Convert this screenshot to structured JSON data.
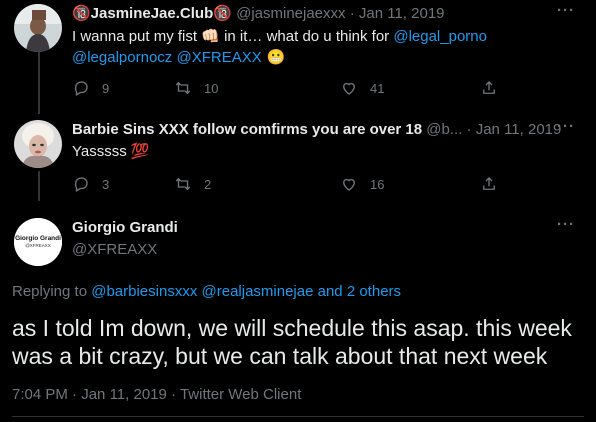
{
  "tweets": [
    {
      "display_name": "🔞JasmineJae.Club🔞",
      "handle": "@jasminejaexxx",
      "separator": "·",
      "time": "Jan 11, 2019",
      "text_parts": [
        {
          "t": "I wanna put my fist ",
          "link": false
        },
        {
          "t": "👊🏻",
          "link": false
        },
        {
          "t": " in it… what do u think for ",
          "link": false
        },
        {
          "t": "@legal_porno",
          "link": true
        }
      ],
      "text_parts_2": [
        {
          "t": "@legalpornocz",
          "link": true
        },
        {
          "t": " ",
          "link": false
        },
        {
          "t": "@XFREAXX",
          "link": true
        },
        {
          "t": " 😬",
          "link": false
        }
      ],
      "replies": "9",
      "retweets": "10",
      "likes": "41",
      "avatar_icon": "profile-photo"
    },
    {
      "display_name": "Barbie Sins XXX follow comfirms you are over 18",
      "handle": "@b...",
      "separator": "·",
      "time": "Jan 11, 2019",
      "text": "Yasssss 💯",
      "replies": "3",
      "retweets": "2",
      "likes": "16",
      "avatar_icon": "profile-photo"
    }
  ],
  "main_tweet": {
    "display_name": "Giorgio Grandi",
    "handle": "@XFREAXX",
    "avatar_title": "Giorgio Grandi",
    "avatar_subtitle": "@XFREAXX",
    "replying_to_label": "Replying to",
    "replying_to": [
      {
        "t": "@barbiesinsxxx",
        "link": true
      },
      {
        "t": " ",
        "link": false
      },
      {
        "t": "@realjasminejae",
        "link": true
      },
      {
        "t": " and ",
        "link": true
      },
      {
        "t": "2 others",
        "link": true
      }
    ],
    "text": "as I told Im down, we will schedule this asap. this week was a bit crazy, but we can talk about that next week",
    "time": "7:04 PM",
    "separator": "·",
    "date": "Jan 11, 2019",
    "source": "Twitter Web Client"
  },
  "colors": {
    "background": "#000000",
    "text": "#e7e9ea",
    "muted": "#71767b",
    "link": "#1d9bf0"
  }
}
